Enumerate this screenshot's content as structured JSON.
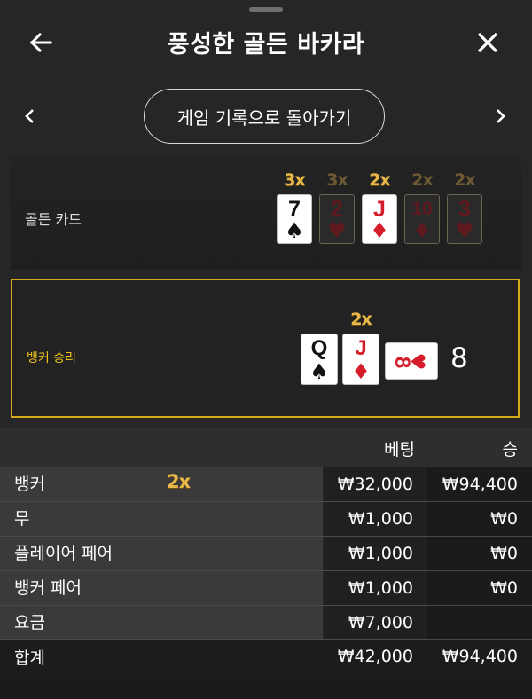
{
  "header": {
    "title": "풍성한 골든 바카라",
    "back_icon": "arrow-left-icon",
    "close_icon": "close-icon"
  },
  "nav": {
    "history_button": "게임 기록으로 돌아가기",
    "prev_icon": "chevron-left-icon",
    "next_icon": "chevron-right-icon"
  },
  "golden_cards": {
    "label": "골든 카드",
    "cards": [
      {
        "multiplier": "3x",
        "rank": "7",
        "suit": "♠",
        "color": "black",
        "active": true
      },
      {
        "multiplier": "3x",
        "rank": "2",
        "suit": "♥",
        "color": "red",
        "active": false
      },
      {
        "multiplier": "2x",
        "rank": "J",
        "suit": "♦",
        "color": "red",
        "active": true
      },
      {
        "multiplier": "2x",
        "rank": "10",
        "suit": "♦",
        "color": "red",
        "active": false
      },
      {
        "multiplier": "2x",
        "rank": "3",
        "suit": "♥",
        "color": "red",
        "active": false
      }
    ]
  },
  "result": {
    "label": "뱅커 승리",
    "multiplier": "2x",
    "cards": [
      {
        "rank": "Q",
        "suit": "♠",
        "color": "black"
      },
      {
        "rank": "J",
        "suit": "♦",
        "color": "red"
      },
      {
        "rank": "8",
        "suit": "♥",
        "color": "red"
      }
    ],
    "score": "8"
  },
  "bets": {
    "columns": {
      "bet": "베팅",
      "win": "승"
    },
    "rows": [
      {
        "label": "뱅커",
        "multiplier": "2x",
        "bet": "₩32,000",
        "win": "₩94,400"
      },
      {
        "label": "무",
        "multiplier": "",
        "bet": "₩1,000",
        "win": "₩0"
      },
      {
        "label": "플레이어 페어",
        "multiplier": "",
        "bet": "₩1,000",
        "win": "₩0"
      },
      {
        "label": "뱅커 페어",
        "multiplier": "",
        "bet": "₩1,000",
        "win": "₩0"
      },
      {
        "label": "요금",
        "multiplier": "",
        "bet": "₩7,000",
        "win": ""
      }
    ],
    "total": {
      "label": "합계",
      "bet": "₩42,000",
      "win": "₩94,400"
    }
  },
  "colors": {
    "accent_gold": "#d4aa1b",
    "multiplier_gold": "#e8b94a",
    "card_red": "#d41c2a"
  }
}
